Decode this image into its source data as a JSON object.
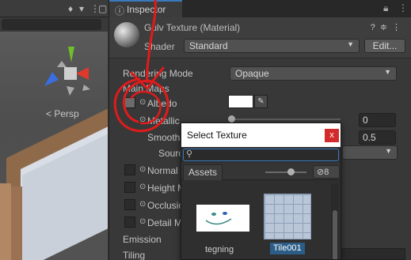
{
  "colors": {
    "annotation_red": "#e11b1b",
    "selection_blue": "#2c5d87",
    "close_red": "#d32b2b",
    "tab_accent": "#3a79bb"
  },
  "scene": {
    "persp_label": "< Persp",
    "gizmo_axis_colors": [
      "#e0392b",
      "#6fbf2a",
      "#3a6ee0"
    ]
  },
  "inspector": {
    "tab_label": "Inspector",
    "tab_icon": "info-icon",
    "tabbar_icons": [
      "lock-icon",
      "kebab-menu-icon"
    ],
    "material_title": "Gulv Texture (Material)",
    "header_icons": [
      "help-icon",
      "preset-icon",
      "kebab-menu-icon"
    ],
    "shader_label": "Shader",
    "shader_value": "Standard",
    "edit_label": "Edit...",
    "rendering_mode_label": "Rendering Mode",
    "rendering_mode_value": "Opaque",
    "main_maps_label": "Main Maps",
    "albedo_label": "Albedo",
    "metallic_label": "Metallic",
    "metallic_value": "0",
    "smoothness_label": "Smoothness",
    "smoothness_value": "0.5",
    "source_label": "Source",
    "normal_label": "Normal Map",
    "height_label": "Height Map",
    "occlusion_label": "Occlusion",
    "detail_label": "Detail Mask",
    "emission_label": "Emission",
    "tiling_label": "Tiling"
  },
  "dialog": {
    "title": "Select Texture",
    "close_label": "x",
    "search_value": "",
    "assets_tab": "Assets",
    "hidden_count": "8",
    "items": [
      {
        "name": "tegning",
        "selected": false
      },
      {
        "name": "Tile001",
        "selected": true
      }
    ]
  }
}
